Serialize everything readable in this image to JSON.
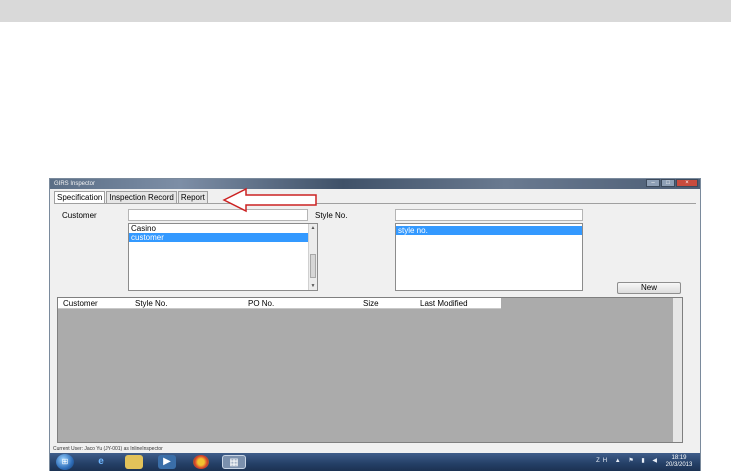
{
  "window": {
    "title": "GIRS Inspector",
    "controls": [
      "–",
      "□",
      "×"
    ]
  },
  "tabs": [
    "Specification",
    "Inspection Record",
    "Report"
  ],
  "form": {
    "customer_label": "Customer",
    "customer_filter_value": "",
    "customer_list": [
      "Casino",
      "customer"
    ],
    "customer_selected": "customer",
    "style_label": "Style No.",
    "style_filter_value": "",
    "style_list": [
      "style no."
    ],
    "style_selected": "style no.",
    "new_button": "New"
  },
  "grid": {
    "columns": [
      "Customer",
      "Style No.",
      "PO No.",
      "Size",
      "Last Modified"
    ]
  },
  "status_text": "Current User: Jaco Yu (JY-001) as InlineInspector",
  "taskbar": {
    "clock_time": "18:19",
    "clock_date": "20/3/2013",
    "tray_lang": "ZH"
  },
  "colors": {
    "selection": "#3399ff",
    "grid_bg": "#ababab",
    "arrow": "#cc2222",
    "taskbar": "#243f66"
  }
}
